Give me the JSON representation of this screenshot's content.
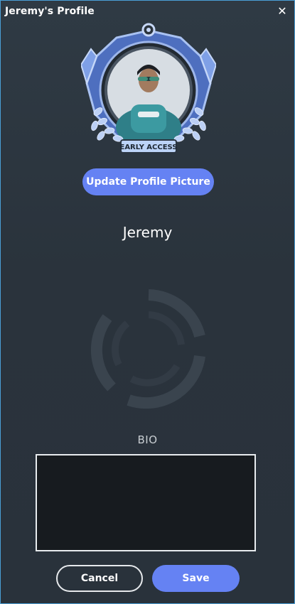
{
  "window": {
    "title": "Jeremy's Profile",
    "close_icon": "close-icon"
  },
  "profile": {
    "badge_text": "EARLY ACCESS",
    "update_picture_label": "Update Profile Picture",
    "username": "Jeremy"
  },
  "bio": {
    "label": "BIO",
    "value": ""
  },
  "actions": {
    "cancel_label": "Cancel",
    "save_label": "Save"
  },
  "colors": {
    "accent": "#6582f3",
    "window_border": "#4a9fd6",
    "background": "#2c353e",
    "bio_background": "#171b1f"
  }
}
